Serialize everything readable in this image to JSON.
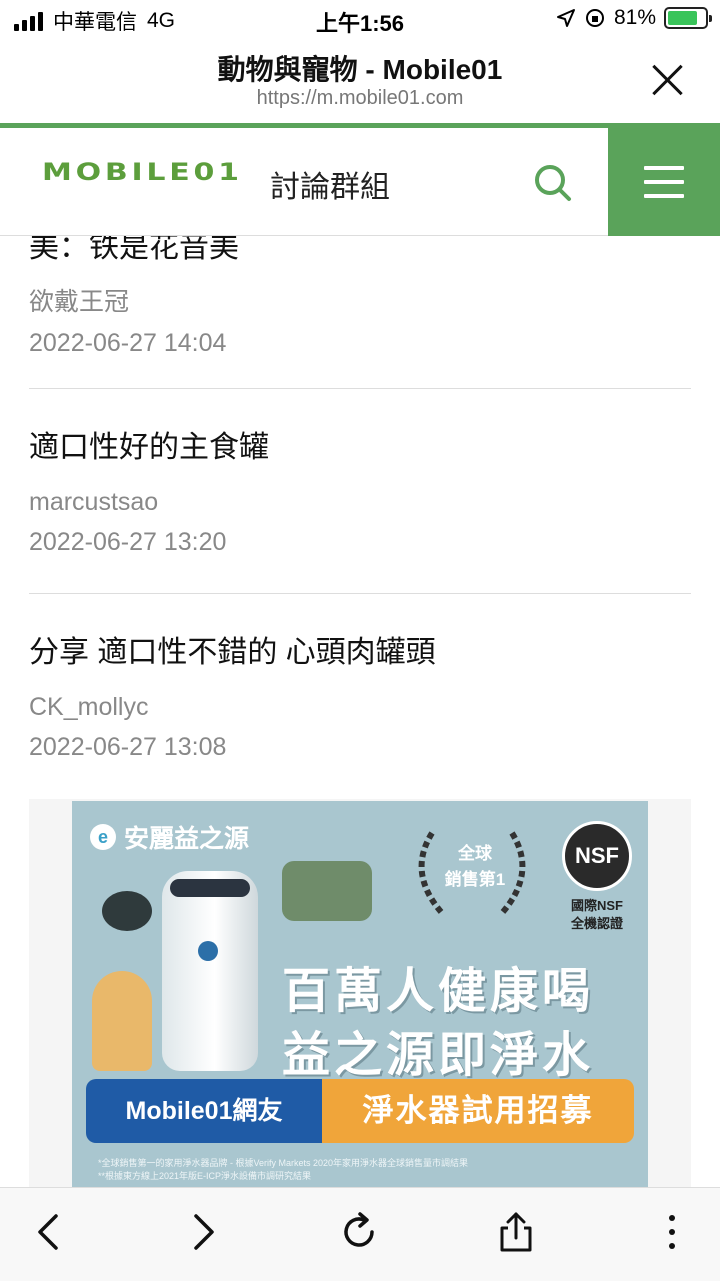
{
  "status_bar": {
    "carrier": "中華電信",
    "network": "4G",
    "time": "上午1:56",
    "battery_percent": "81%",
    "battery_level": 0.81
  },
  "url_bar": {
    "title": "動物與寵物 - Mobile01",
    "host": "https://m.mobile01.com"
  },
  "site_header": {
    "logo_text": "MOBILE01",
    "section_title": "討論群組",
    "accent_color": "#5aa35a"
  },
  "posts": [
    {
      "title": "美：铁是花音美",
      "author": "欲戴王冠",
      "date": "2022-06-27 14:04"
    },
    {
      "title": "適口性好的主食罐",
      "author": "marcustsao",
      "date": "2022-06-27 13:20"
    },
    {
      "title": "分享 適口性不錯的 心頭肉罐頭",
      "author": "CK_mollyc",
      "date": "2022-06-27 13:08"
    }
  ],
  "ad": {
    "brand": "安麗益之源",
    "laurel_text": "全球\n銷售第1",
    "nsf_badge": "NSF",
    "nsf_caption": "國際NSF\n全機認證",
    "headline_line1": "百萬人健康喝",
    "headline_line2": "益之源即淨水",
    "banner_left": "Mobile01網友",
    "banner_right": "淨水器試用招募",
    "fine_print_1": "*全球銷售第一的家用淨水器品牌 - 根據Verify Markets 2020年家用淨水器全球銷售量市調結果",
    "fine_print_2": "**根據東方線上2021年版E-ICP淨水設備市調研究結果"
  },
  "toolbar": {
    "icons": [
      "back-icon",
      "forward-icon",
      "reload-icon",
      "share-icon",
      "more-icon"
    ]
  }
}
